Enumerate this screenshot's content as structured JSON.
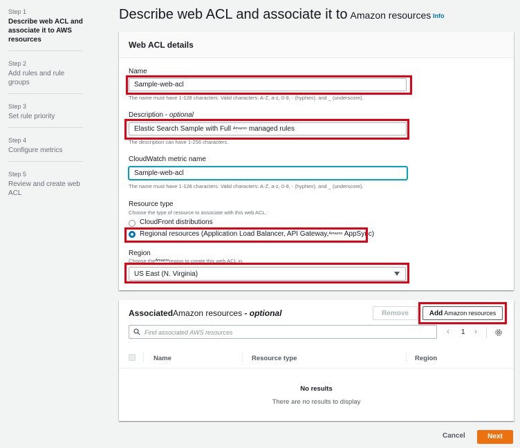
{
  "steps": [
    {
      "num": "Step 1",
      "title": "Describe web ACL and associate it to AWS resources"
    },
    {
      "num": "Step 2",
      "title": "Add rules and rule groups"
    },
    {
      "num": "Step 3",
      "title": "Set rule priority"
    },
    {
      "num": "Step 4",
      "title": "Configure metrics"
    },
    {
      "num": "Step 5",
      "title": "Review and create web ACL"
    }
  ],
  "page": {
    "title_main": "Describe web ACL and associate it to",
    "title_tail": "Amazon resources",
    "info": "Info"
  },
  "details": {
    "heading": "Web ACL details",
    "name_label": "Name",
    "name_value": "Sample-web-acl",
    "name_hint": "The name must have 1-128 characters. Valid characters: A-Z, a-z, 0-9, - (hyphen), and _ (underscore).",
    "desc_label": "Description - ",
    "desc_optional": "optional",
    "desc_value_a": "Elastic Search Sample with Full",
    "desc_value_tiny": "Amazon",
    "desc_value_b": "managed rules",
    "desc_hint": "The description can have 1-256 characters.",
    "metric_label": "CloudWatch metric name",
    "metric_value": "Sample-web-acl",
    "metric_hint": "The name must have 1-128 characters. Valid characters: A-Z, a-z, 0-9, - (hyphen), and _ (underscore).",
    "resource_label": "Resource type",
    "resource_hint": "Choose the type of resource to associate with this web ACL.",
    "opt_cloudfront": "CloudFront distributions",
    "opt_regional_a": "Regional resources (Application Load Balancer, API Gateway,",
    "opt_regional_tiny": "Amazon",
    "opt_regional_b": "AppSync)",
    "region_label": "Region",
    "region_hint_a": "Choose the",
    "region_hint_tiny": "Amazon",
    "region_hint_b": "region to create this web ACL in.",
    "region_value": "US East (N. Virginia)"
  },
  "assoc": {
    "heading_a": "Associated",
    "heading_b": "Amazon resources",
    "heading_opt": " - optional",
    "remove": "Remove",
    "add_a": "Add",
    "add_b": "Amazon resources",
    "search_placeholder": "Find associated AWS resources",
    "page": "1",
    "col_name": "Name",
    "col_type": "Resource type",
    "col_region": "Region",
    "empty_title": "No results",
    "empty_sub": "There are no results to display"
  },
  "footer": {
    "cancel": "Cancel",
    "next": "Next"
  },
  "colors": {
    "accent": "#0073bb",
    "primary_button": "#ec7211",
    "highlight": "#e60012"
  }
}
